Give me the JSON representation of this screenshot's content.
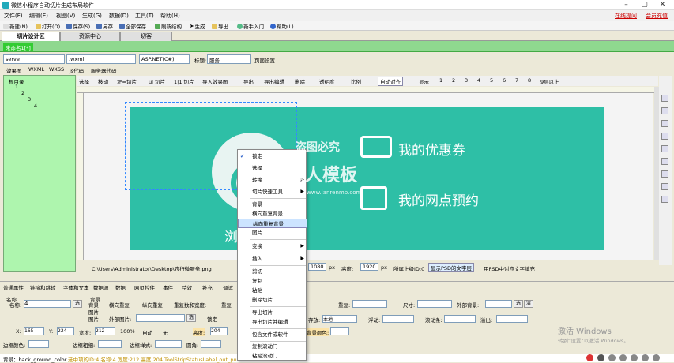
{
  "window": {
    "title": "微信小程序自动切片生成布局软件"
  },
  "menu": {
    "items": [
      "文件(F)",
      "编辑(E)",
      "视图(V)",
      "生成(G)",
      "数据(D)",
      "工具(T)",
      "帮助(H)"
    ],
    "online": "在线提问",
    "vip": "会员充值"
  },
  "toolbar": {
    "new": "新建(N)",
    "open": "打开(O)",
    "save": "保存(S)",
    "saveas": "另存",
    "saveall": "全部保存",
    "refresh": "刷新结构",
    "generate": "生成",
    "export": "导出",
    "newbie": "新手入门",
    "help": "帮助(L)"
  },
  "tabs": [
    "切片设计区",
    "资源中心",
    "切客"
  ],
  "doc_tab": "未命名1[*]",
  "row3": {
    "name": "serve",
    "ext": ".wxml",
    "lang": "ASP.NET(C#)",
    "title_label": "标题:",
    "title_value": "服务",
    "page_settings": "页面设置"
  },
  "subtabs": [
    "效果图",
    "WXML",
    "WXSS",
    "js代码",
    "服务器代码"
  ],
  "tree": [
    "根目录",
    "1",
    "2",
    "3",
    "4"
  ],
  "tools": {
    "select": "选择",
    "move": "移动",
    "left_slice": "左=切片",
    "up_slice": "ul 切片",
    "ul_slice": "1|1 切片",
    "import": "导入效果图",
    "export": "导出",
    "export_edit": "导出编辑",
    "delete": "删除",
    "transparent": "透明度",
    "ratio": "比例",
    "auto_align": "自动对齐",
    "display": "显示",
    "checks": [
      "1",
      "2",
      "3",
      "4",
      "5",
      "6",
      "7",
      "8"
    ],
    "more": "9层以上"
  },
  "banner": {
    "text1": "我的优惠券",
    "text2": "我的网点预约",
    "overlay": "浏"
  },
  "watermark": {
    "line1": "盗图必究",
    "line2": "懒人模板",
    "line3": "www.lanrenmb.com"
  },
  "status": {
    "path": "C:\\Users\\Administrator\\Desktop\\农行微服务.png",
    "width_label": "",
    "width_value": "1080",
    "px1": "px",
    "height_label": "高度:",
    "height_value": "1920",
    "px2": "px",
    "layer": "所属上级ID:0",
    "show_psd_text": "显示PSD的文字层",
    "use_psd_text": "用PSD中对应文字填充"
  },
  "prop_tabs": [
    "普通属性",
    "链接和跳转",
    "字体和文本",
    "数据源",
    "数据",
    "网页控件",
    "事件",
    "特效",
    "补充",
    "调试"
  ],
  "props": {
    "name_label": "名称:",
    "name_value": "4",
    "bg": "背景",
    "bg_label": "名称",
    "bg_check": "背景",
    "h_repeat": "横向重复",
    "v_repeat": "纵向重复",
    "repeat_width": "重复数和宽度:",
    "repeat_h": "重复",
    "image_label": "图片",
    "image_check": "图片",
    "ext_image": "外部图片:",
    "x_label": "X:",
    "x_value": "165",
    "y_label": "Y:",
    "y_value": "224",
    "w_label": "宽度:",
    "w_value": "212",
    "pct": "100%",
    "auto": "自动",
    "none": "无",
    "lock": "锁定",
    "h_label": "高度:",
    "h_value": "204",
    "border_color": "边框颜色:",
    "border_width": "边框粗细:",
    "border_style": "边框样式:",
    "radius": "圆角:",
    "repeat": "重复:",
    "size": "尺寸:",
    "ext_bg": "外部背景:",
    "exist": "存放:",
    "exist_val": "本地",
    "float": "浮动:",
    "scroll": "滚动条:",
    "overflow": "溢出:",
    "bg_color": "背景颜色:",
    "choose": "选",
    "clear": "清"
  },
  "statusbar": {
    "text1": "背景：back_ground_color",
    "text2": "选中项的ID:4 名称:4 宽度:212 高度:204 ToolStripStatusLabel_out_pu"
  },
  "context_menu": [
    {
      "label": "锁定",
      "checked": true
    },
    {
      "label": "选择"
    },
    {
      "label": "转换",
      "sub": true
    },
    {
      "label": "切片快速工具",
      "sub": true
    },
    {
      "label": "背景"
    },
    {
      "label": "横向重复背景"
    },
    {
      "label": "纵向重复背景",
      "highlight": true
    },
    {
      "label": "图片"
    },
    {
      "label": "变换",
      "sub": true
    },
    {
      "label": "插入",
      "sub": true
    },
    {
      "label": "剪切"
    },
    {
      "label": "复制"
    },
    {
      "label": "粘贴"
    },
    {
      "label": "删除切片"
    },
    {
      "label": "导出切片"
    },
    {
      "label": "导出切片并编辑"
    },
    {
      "label": "包含文件或软件"
    },
    {
      "label": "复制滚动门"
    },
    {
      "label": "粘贴滚动门"
    }
  ],
  "windows_activation": {
    "line1": "激活 Windows",
    "line2": "转到“设置”以激活 Windows。"
  },
  "colors": {
    "banner": "#2ebfa6",
    "tree_bg": "#aef5ae",
    "green_bar": "#8fd88f",
    "highlight": "#cce4ff"
  }
}
